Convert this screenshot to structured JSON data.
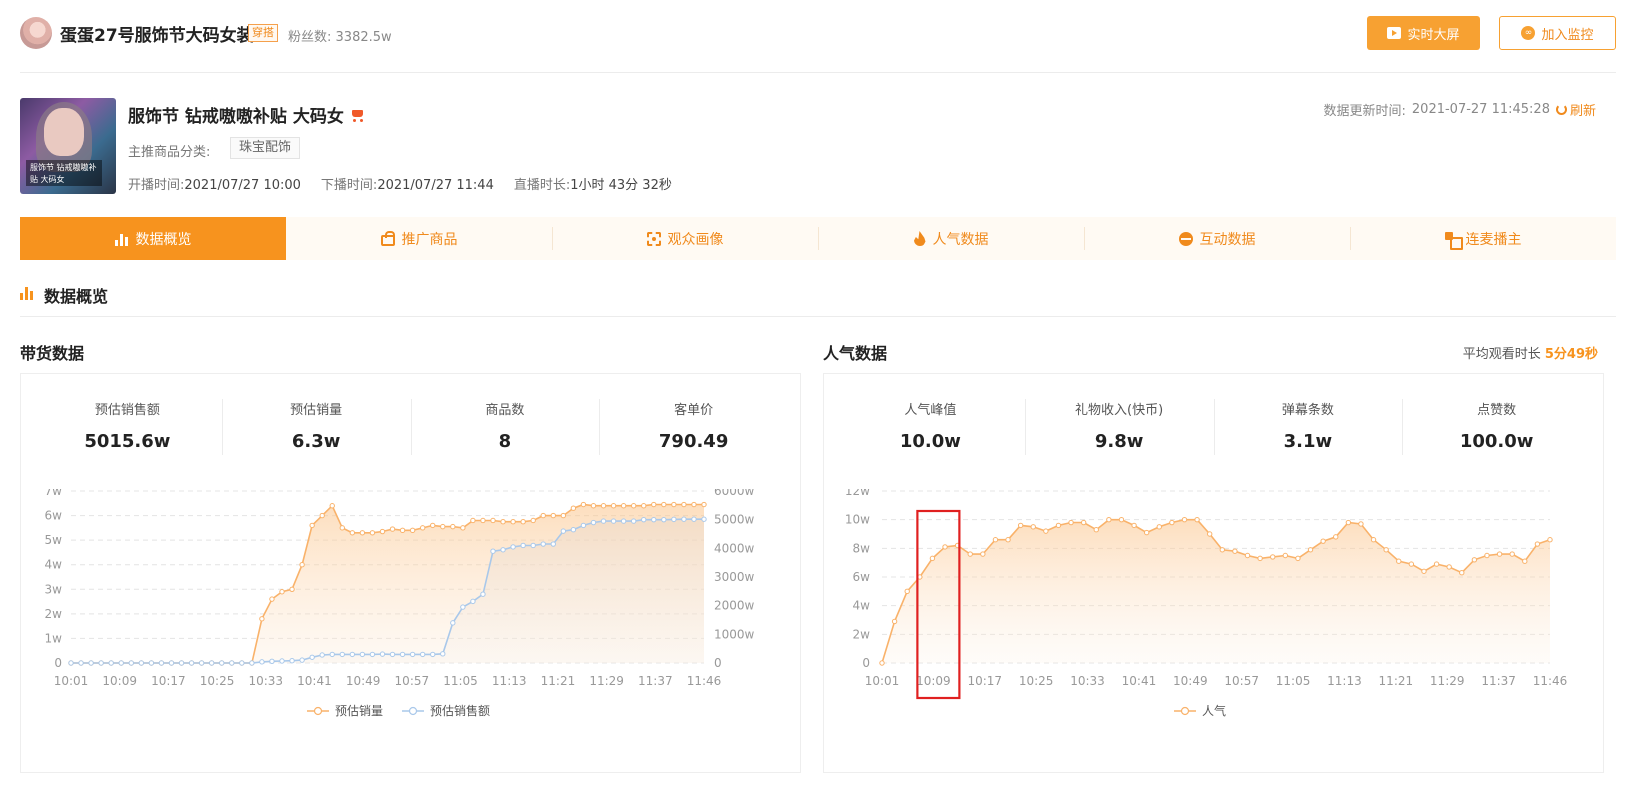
{
  "header": {
    "anchor_name": "蛋蛋27号服饰节大码女装",
    "anchor_tag": "穿搭",
    "fans_label": "粉丝数:",
    "fans_value": "3382.5w",
    "btn_live_screen": "实时大屏",
    "btn_monitor": "加入监控"
  },
  "live": {
    "title": "服饰节 钻戒嗷嗷补贴 大码女",
    "cover_caption": "服饰节 钻戒嗷嗷补贴 大码女",
    "category_label": "主推商品分类:",
    "category_value": "珠宝配饰",
    "start_label": "开播时间:",
    "start_value": "2021/07/27 10:00",
    "end_label": "下播时间:",
    "end_value": "2021/07/27 11:44",
    "duration_label": "直播时长:",
    "duration_value": "1小时 43分 32秒",
    "update_label": "数据更新时间:",
    "update_value": "2021-07-27 11:45:28",
    "refresh": "刷新"
  },
  "tabs": [
    {
      "label": "数据概览",
      "icon": "bar-chart-icon",
      "active": true
    },
    {
      "label": "推广商品",
      "icon": "shopping-bag-icon",
      "active": false
    },
    {
      "label": "观众画像",
      "icon": "face-scan-icon",
      "active": false
    },
    {
      "label": "人气数据",
      "icon": "fire-icon",
      "active": false
    },
    {
      "label": "互动数据",
      "icon": "pulse-icon",
      "active": false
    },
    {
      "label": "连麦播主",
      "icon": "link-squares-icon",
      "active": false
    }
  ],
  "section_title": "数据概览",
  "sales_panel": {
    "title": "带货数据",
    "stats": [
      {
        "label": "预估销售额",
        "value": "5015.6w"
      },
      {
        "label": "预估销量",
        "value": "6.3w"
      },
      {
        "label": "商品数",
        "value": "8"
      },
      {
        "label": "客单价",
        "value": "790.49"
      }
    ]
  },
  "popularity_panel": {
    "title": "人气数据",
    "avg_watch_label": "平均观看时长",
    "avg_watch_value": "5分49秒",
    "stats": [
      {
        "label": "人气峰值",
        "value": "10.0w"
      },
      {
        "label": "礼物收入(快币)",
        "value": "9.8w"
      },
      {
        "label": "弹幕条数",
        "value": "3.1w"
      },
      {
        "label": "点赞数",
        "value": "100.0w"
      }
    ]
  },
  "colors": {
    "accent": "#f7931e",
    "series_orange": "#f9b26a",
    "series_blue": "#a9c8ea",
    "highlight": "#e02020"
  },
  "chart_data": [
    {
      "type": "line",
      "x_labels": [
        "10:01",
        "10:09",
        "10:17",
        "10:25",
        "10:33",
        "10:41",
        "10:49",
        "10:57",
        "11:05",
        "11:13",
        "11:21",
        "11:29",
        "11:37",
        "11:46"
      ],
      "y_ticks_left": [
        "0",
        "1w",
        "2w",
        "3w",
        "4w",
        "5w",
        "6w",
        "7w"
      ],
      "y_ticks_right": [
        "0",
        "1000w",
        "2000w",
        "3000w",
        "4000w",
        "5000w",
        "6000w"
      ],
      "ylim_left": [
        0,
        7
      ],
      "ylim_right": [
        0,
        6000
      ],
      "legend_position": "bottom-center",
      "grid": true,
      "series": [
        {
          "name": "预估销量",
          "axis": "left",
          "unit": "w",
          "values": [
            0,
            0,
            0,
            0,
            0,
            0,
            0,
            0,
            0,
            0,
            0,
            0,
            0,
            0,
            0,
            0,
            0,
            0,
            0,
            1.8,
            2.6,
            2.9,
            3.0,
            4.0,
            5.6,
            6.0,
            6.4,
            5.5,
            5.3,
            5.3,
            5.3,
            5.35,
            5.45,
            5.4,
            5.4,
            5.5,
            5.6,
            5.55,
            5.55,
            5.5,
            5.8,
            5.8,
            5.8,
            5.75,
            5.75,
            5.75,
            5.8,
            6.0,
            6.0,
            6.0,
            6.3,
            6.45,
            6.4,
            6.4,
            6.4,
            6.4,
            6.4,
            6.4,
            6.45,
            6.45,
            6.45,
            6.45,
            6.45,
            6.45
          ]
        },
        {
          "name": "预估销售额",
          "axis": "right",
          "unit": "w",
          "values": [
            0,
            0,
            0,
            0,
            0,
            0,
            0,
            0,
            0,
            0,
            0,
            0,
            0,
            0,
            0,
            0,
            0,
            0,
            0,
            40,
            60,
            70,
            80,
            100,
            200,
            280,
            300,
            300,
            300,
            300,
            300,
            310,
            300,
            300,
            300,
            300,
            300,
            320,
            1400,
            1950,
            2150,
            2400,
            3900,
            3950,
            4050,
            4100,
            4100,
            4150,
            4150,
            4600,
            4650,
            4800,
            4900,
            4950,
            4950,
            4950,
            4950,
            5000,
            5000,
            5000,
            5010,
            5015,
            5015,
            5015
          ]
        }
      ]
    },
    {
      "type": "line",
      "x_labels": [
        "10:01",
        "10:09",
        "10:17",
        "10:25",
        "10:33",
        "10:41",
        "10:49",
        "10:57",
        "11:05",
        "11:13",
        "11:21",
        "11:29",
        "11:37",
        "11:46"
      ],
      "y_ticks": [
        "0",
        "2w",
        "4w",
        "6w",
        "8w",
        "10w",
        "12w"
      ],
      "ylim": [
        0,
        12
      ],
      "legend_position": "bottom-center",
      "grid": true,
      "annotation": {
        "type": "highlight-box",
        "label": "10:09"
      },
      "series": [
        {
          "name": "人气",
          "unit": "w",
          "values": [
            0,
            2.9,
            5.0,
            6.0,
            7.3,
            8.1,
            8.2,
            7.6,
            7.6,
            8.6,
            8.6,
            9.6,
            9.5,
            9.2,
            9.6,
            9.8,
            9.8,
            9.3,
            10.0,
            10.0,
            9.6,
            9.1,
            9.5,
            9.8,
            10.0,
            10.0,
            9.0,
            7.9,
            7.8,
            7.5,
            7.3,
            7.4,
            7.5,
            7.3,
            7.9,
            8.5,
            8.8,
            9.8,
            9.7,
            8.6,
            7.9,
            7.1,
            6.9,
            6.4,
            6.9,
            6.7,
            6.3,
            7.2,
            7.5,
            7.6,
            7.6,
            7.1,
            8.3,
            8.6
          ]
        }
      ]
    }
  ]
}
